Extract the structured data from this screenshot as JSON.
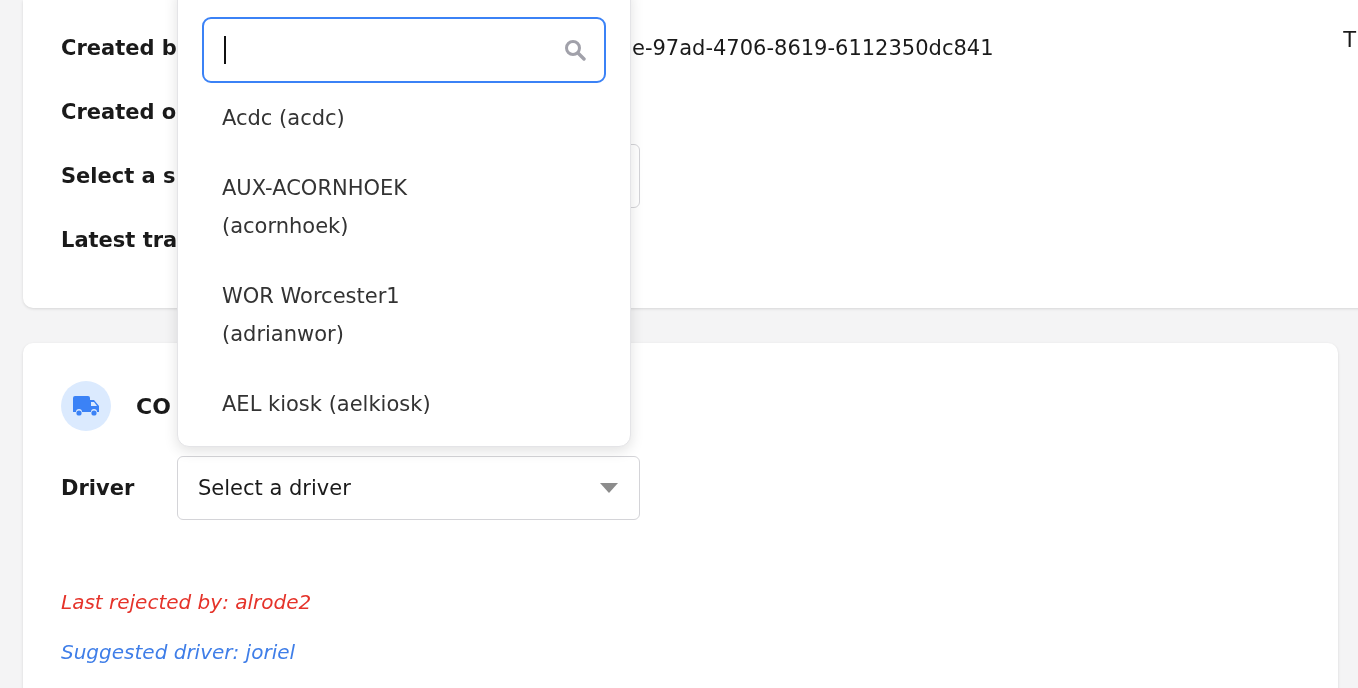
{
  "details": [
    {
      "kind": "text",
      "label": "Created b",
      "value": "e-97ad-4706-8619-6112350dc841"
    },
    {
      "kind": "text",
      "label": "Created o"
    },
    {
      "kind": "select",
      "label": "Select a s"
    },
    {
      "kind": "text",
      "label": "Latest tra"
    }
  ],
  "edge_text": "T",
  "dropdown": {
    "search": {
      "focused": true
    },
    "options": [
      {
        "label": "Acdc (acdc)"
      },
      {
        "label": "AUX-ACORNHOEK (acornhoek)"
      },
      {
        "label": "WOR Worcester1 (adrianwor)"
      },
      {
        "label": "AEL kiosk (aelkiosk)"
      }
    ]
  },
  "section": {
    "title": "CO",
    "driver": {
      "label": "Driver",
      "placeholder": "Select a driver"
    },
    "rejected": "Last rejected by: alrode2",
    "suggested": "Suggested driver: joriel"
  }
}
